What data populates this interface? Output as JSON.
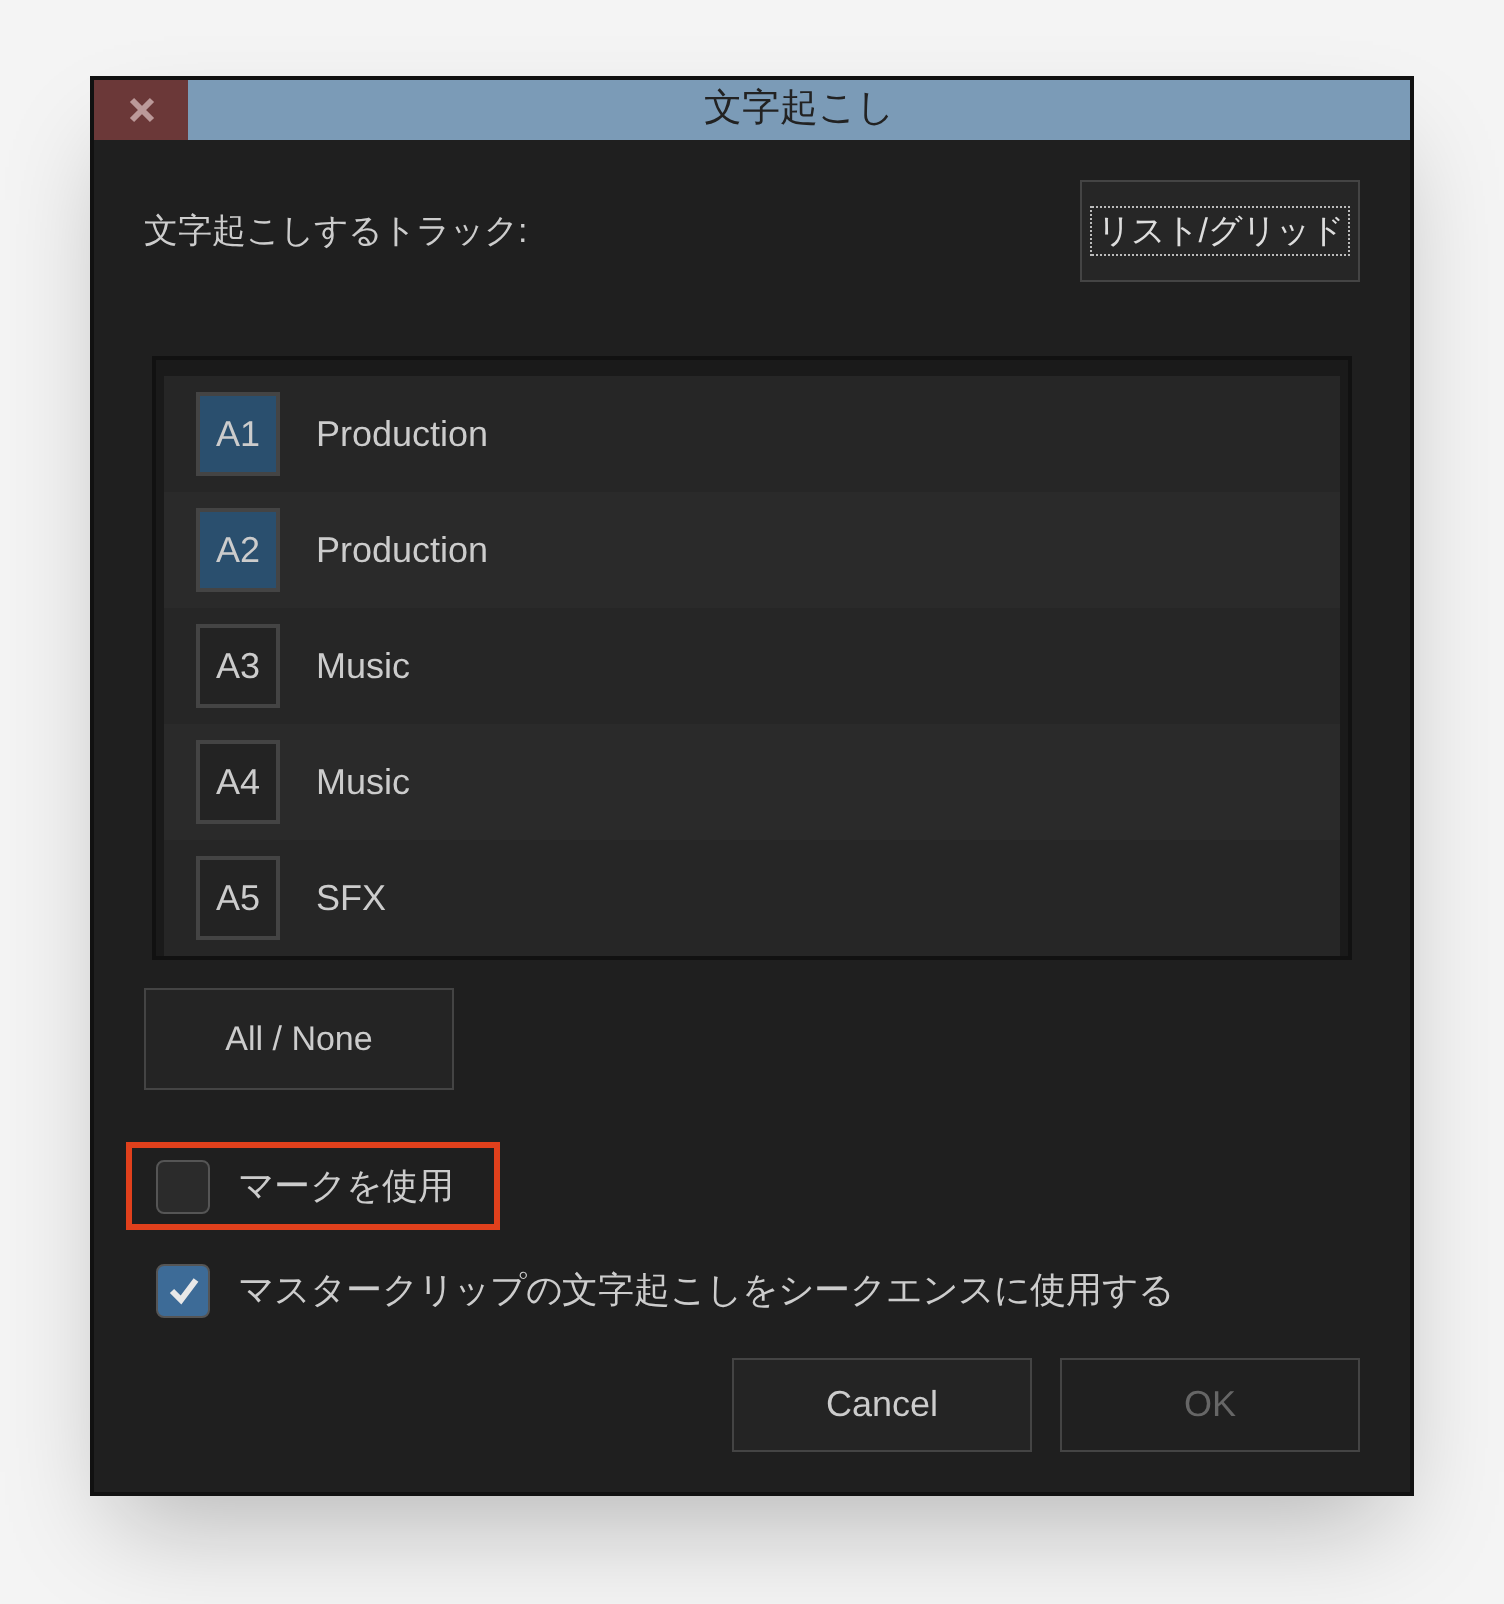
{
  "window": {
    "title": "文字起こし"
  },
  "track_label": "文字起こしするトラック:",
  "view_toggle": {
    "label": "リスト/グリッド",
    "focused": true
  },
  "tracks": [
    {
      "id": "A1",
      "name": "Production",
      "selected": true
    },
    {
      "id": "A2",
      "name": "Production",
      "selected": true
    },
    {
      "id": "A3",
      "name": "Music",
      "selected": false
    },
    {
      "id": "A4",
      "name": "Music",
      "selected": false
    },
    {
      "id": "A5",
      "name": "SFX",
      "selected": false
    }
  ],
  "all_none": "All / None",
  "options": [
    {
      "label": "マークを使用",
      "checked": false,
      "highlighted": true
    },
    {
      "label": "マスタークリップの文字起こしをシークエンスに使用する",
      "checked": true,
      "highlighted": false
    }
  ],
  "buttons": [
    {
      "label": "Cancel",
      "disabled": false
    },
    {
      "label": "OK",
      "disabled": true
    }
  ]
}
